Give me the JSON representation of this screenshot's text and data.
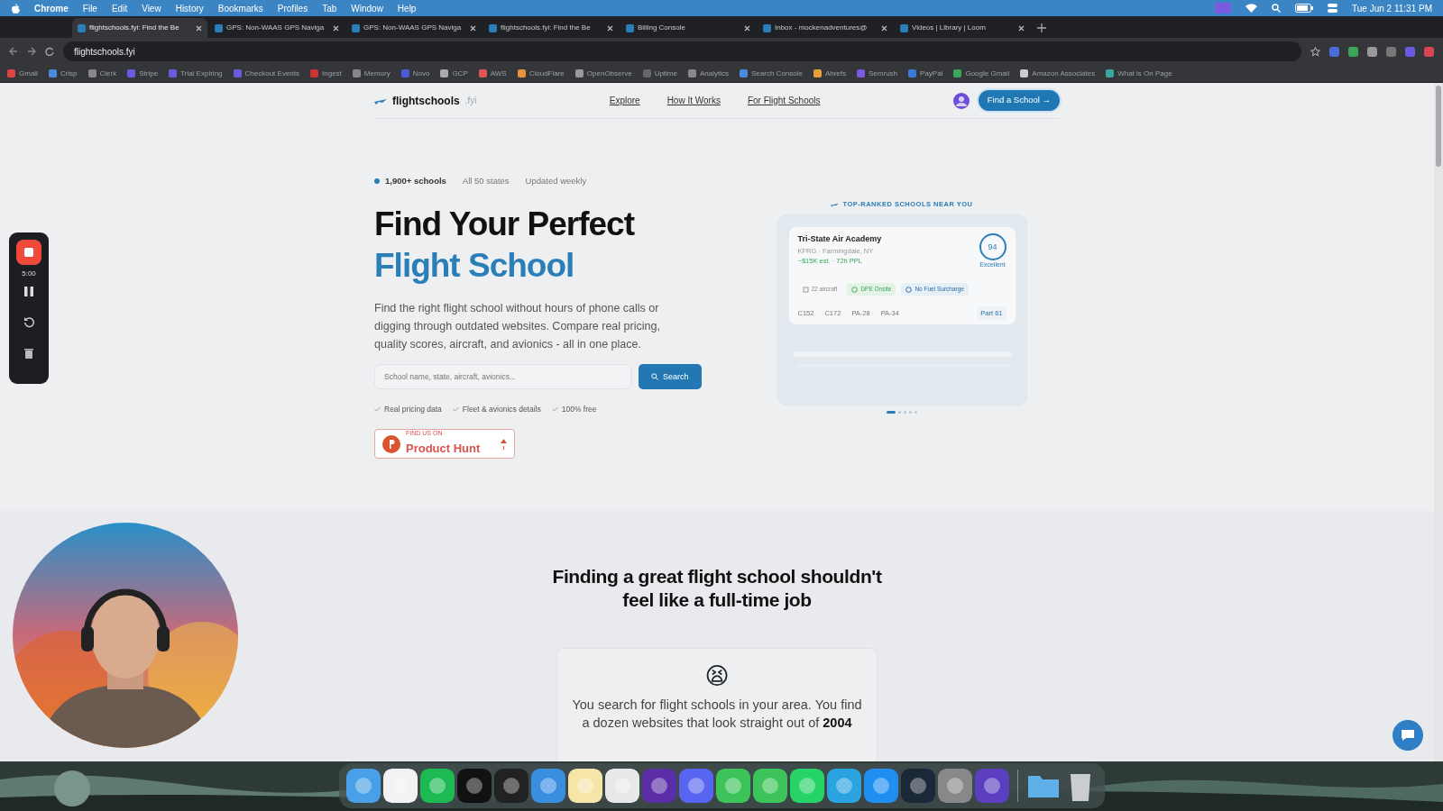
{
  "menubar": {
    "app": "Chrome",
    "menus": [
      "File",
      "Edit",
      "View",
      "History",
      "Bookmarks",
      "Profiles",
      "Tab",
      "Window",
      "Help"
    ],
    "clock": "Tue Jun 2  11:31 PM"
  },
  "tabs": [
    {
      "title": "flightschools.fyi: Find the Be",
      "selected": true
    },
    {
      "title": "GPS: Non-WAAS GPS Naviga",
      "selected": false
    },
    {
      "title": "GPS: Non-WAAS GPS Naviga",
      "selected": false
    },
    {
      "title": "flightschools.fyi: Find the Be",
      "selected": false
    },
    {
      "title": "Billing Console",
      "selected": false
    },
    {
      "title": "Inbox - mockenadventures@",
      "selected": false
    },
    {
      "title": "Videos | Library | Loom",
      "selected": false
    }
  ],
  "address_bar": {
    "url": "flightschools.fyi"
  },
  "bookmarks": [
    "Gmail",
    "Crisp",
    "Clerk",
    "Stripe",
    "Trial Expiring",
    "Checkout Events",
    "Ingest",
    "Memory",
    "Novo",
    "GCP",
    "AWS",
    "CloudFlare",
    "OpenObserve",
    "Uptime",
    "Analytics",
    "Search Console",
    "Ahrefs",
    "Semrush",
    "PayPal",
    "Google Gmail",
    "Amazon Associates",
    "What is On Page"
  ],
  "site": {
    "logo": "flightschools",
    "logo_suffix": ".fyi",
    "nav": [
      "Explore",
      "How It Works",
      "For Flight Schools"
    ],
    "cta": "Find a School →"
  },
  "hero": {
    "stats": [
      "1,900+ schools",
      "All 50 states",
      "Updated weekly"
    ],
    "title_line_1": "Find Your Perfect",
    "title_line_2": "Flight School",
    "description": "Find the right flight school without hours of phone calls or digging through outdated websites. Compare real pricing, quality scores, aircraft, and avionics - all in one place.",
    "search": {
      "placeholder": "School name, state, aircraft, avionics...",
      "button": "Search"
    },
    "checks": [
      "Real pricing data",
      "Fleet & avionics details",
      "100% free"
    ],
    "product_hunt": {
      "caption": "FIND US ON",
      "label": "Product Hunt"
    }
  },
  "carousel": {
    "heading": "TOP-RANKED SCHOOLS NEAR YOU",
    "card": {
      "name": "Tri-State Air Academy",
      "location": "KFRG · Farmingdale, NY",
      "price": "~$15K est. · 72h PPL",
      "score": "94",
      "score_label": "Excellent",
      "tags": [
        {
          "text": "22 aircraft",
          "kind": "plain"
        },
        {
          "text": "DPE Onsite",
          "kind": "success"
        },
        {
          "text": "No Fuel Surcharge",
          "kind": "info"
        }
      ],
      "aircraft": [
        "C152",
        "C172",
        "PA-28",
        "PA-34"
      ],
      "part": "Part 61"
    },
    "pages": [
      {
        "selected": true
      },
      {
        "selected": false
      },
      {
        "selected": false
      },
      {
        "selected": false
      },
      {
        "selected": false
      }
    ]
  },
  "problem": {
    "heading": "Finding a great flight school shouldn't feel like a full-time job",
    "emoji": "😫",
    "text": "You search for flight schools in your area. You find a dozen websites that look straight out of **2004**"
  },
  "recorder": {
    "time": "5:00"
  }
}
